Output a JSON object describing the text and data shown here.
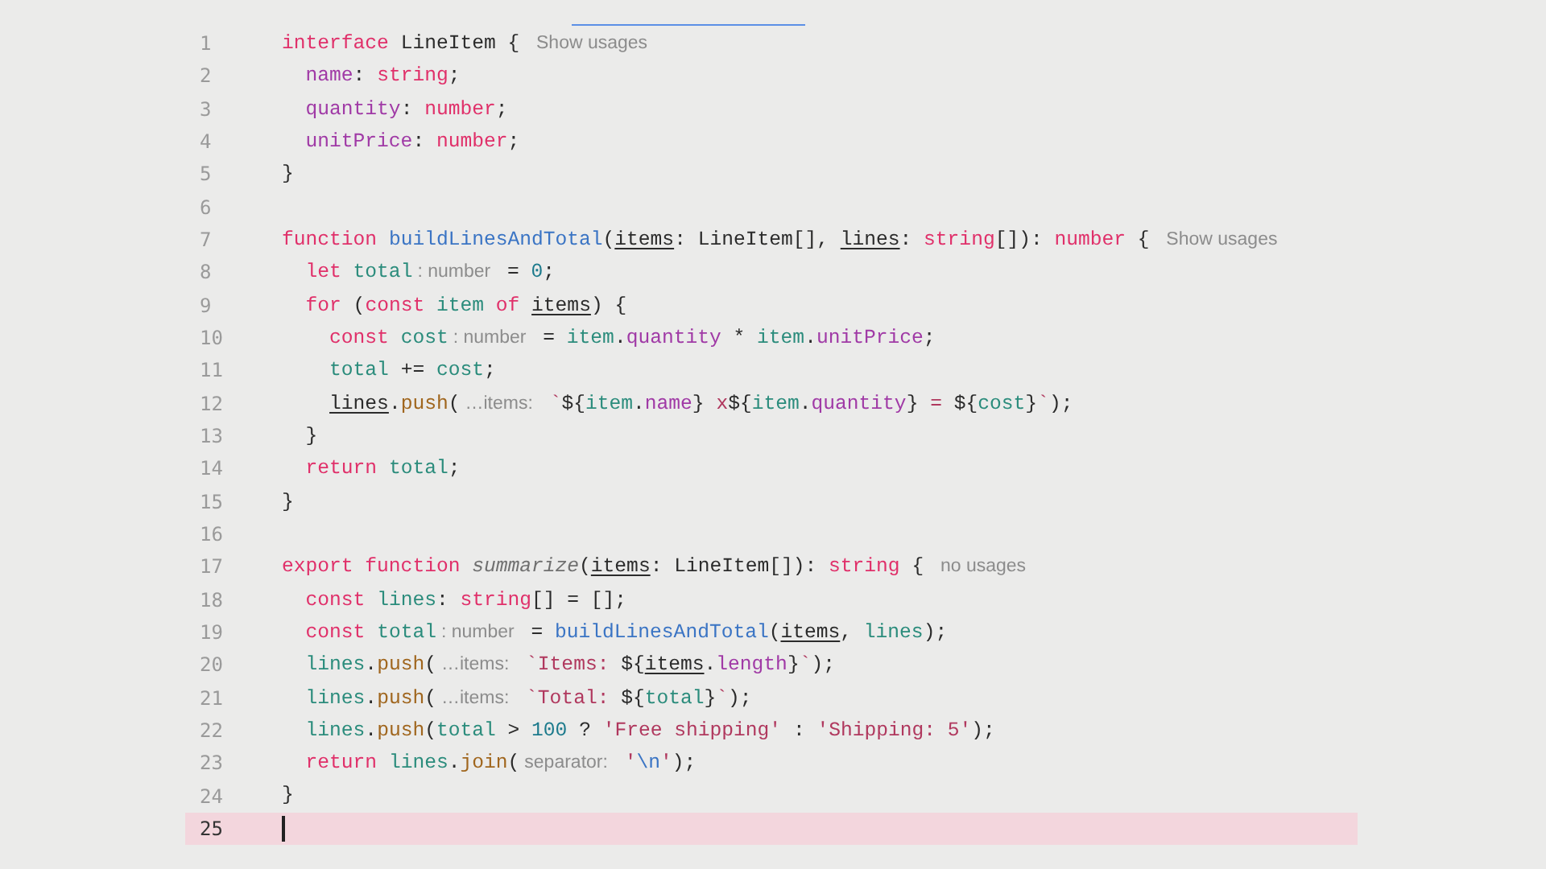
{
  "editor": {
    "lines": [
      {
        "number": "1",
        "current": false,
        "tokens": [
          {
            "text": "interface",
            "kind": "kw"
          },
          {
            "text": " LineItem { ",
            "kind": "plain"
          },
          {
            "text": "Show usages",
            "kind": "hint"
          }
        ]
      },
      {
        "number": "2",
        "current": false,
        "tokens": [
          {
            "text": "  name",
            "kind": "prop"
          },
          {
            "text": ": ",
            "kind": "plain"
          },
          {
            "text": "string",
            "kind": "type"
          },
          {
            "text": ";",
            "kind": "plain"
          }
        ]
      },
      {
        "number": "3",
        "current": false,
        "tokens": [
          {
            "text": "  quantity",
            "kind": "prop"
          },
          {
            "text": ": ",
            "kind": "plain"
          },
          {
            "text": "number",
            "kind": "type"
          },
          {
            "text": ";",
            "kind": "plain"
          }
        ]
      },
      {
        "number": "4",
        "current": false,
        "tokens": [
          {
            "text": "  unitPrice",
            "kind": "prop"
          },
          {
            "text": ": ",
            "kind": "plain"
          },
          {
            "text": "number",
            "kind": "type"
          },
          {
            "text": ";",
            "kind": "plain"
          }
        ]
      },
      {
        "number": "5",
        "current": false,
        "tokens": [
          {
            "text": "}",
            "kind": "plain"
          }
        ]
      },
      {
        "number": "6",
        "current": false
      },
      {
        "number": "7",
        "current": false,
        "tokens": [
          {
            "text": "function",
            "kind": "kw"
          },
          {
            "text": " buildLinesAndTotal",
            "kind": "fn"
          },
          {
            "text": "(",
            "kind": "plain"
          },
          {
            "text": "items",
            "kind": "param"
          },
          {
            "text": ": LineItem[], ",
            "kind": "plain"
          },
          {
            "text": "lines",
            "kind": "param"
          },
          {
            "text": ": ",
            "kind": "plain"
          },
          {
            "text": "string",
            "kind": "type"
          },
          {
            "text": "[]): ",
            "kind": "plain"
          },
          {
            "text": "number",
            "kind": "type"
          },
          {
            "text": " { ",
            "kind": "plain"
          },
          {
            "text": "Show usages",
            "kind": "hint"
          }
        ]
      },
      {
        "number": "8",
        "current": false,
        "tokens": [
          {
            "text": "  let",
            "kind": "kw"
          },
          {
            "text": " total",
            "kind": "var"
          },
          {
            "text": ": number",
            "kind": "hint"
          },
          {
            "text": " = ",
            "kind": "plain"
          },
          {
            "text": "0",
            "kind": "num"
          },
          {
            "text": ";",
            "kind": "plain"
          }
        ]
      },
      {
        "number": "9",
        "current": false,
        "tokens": [
          {
            "text": "  for",
            "kind": "kw"
          },
          {
            "text": " (",
            "kind": "plain"
          },
          {
            "text": "const",
            "kind": "kw"
          },
          {
            "text": " item",
            "kind": "var"
          },
          {
            "text": " of ",
            "kind": "kw"
          },
          {
            "text": "items",
            "kind": "param"
          },
          {
            "text": ") {",
            "kind": "plain"
          }
        ]
      },
      {
        "number": "10",
        "current": false,
        "tokens": [
          {
            "text": "    const",
            "kind": "kw"
          },
          {
            "text": " cost",
            "kind": "var"
          },
          {
            "text": ": number",
            "kind": "hint"
          },
          {
            "text": " = ",
            "kind": "plain"
          },
          {
            "text": "item",
            "kind": "var"
          },
          {
            "text": ".",
            "kind": "plain"
          },
          {
            "text": "quantity",
            "kind": "prop"
          },
          {
            "text": " * ",
            "kind": "plain"
          },
          {
            "text": "item",
            "kind": "var"
          },
          {
            "text": ".",
            "kind": "plain"
          },
          {
            "text": "unitPrice",
            "kind": "prop"
          },
          {
            "text": ";",
            "kind": "plain"
          }
        ]
      },
      {
        "number": "11",
        "current": false,
        "tokens": [
          {
            "text": "    total",
            "kind": "var"
          },
          {
            "text": " += ",
            "kind": "plain"
          },
          {
            "text": "cost",
            "kind": "var"
          },
          {
            "text": ";",
            "kind": "plain"
          }
        ]
      },
      {
        "number": "12",
        "current": false,
        "tokens": [
          {
            "text": "    lines",
            "kind": "param"
          },
          {
            "text": ".",
            "kind": "plain"
          },
          {
            "text": "push",
            "kind": "method"
          },
          {
            "text": "(",
            "kind": "plain"
          },
          {
            "text": "…items:",
            "kind": "hint"
          },
          {
            "text": " `",
            "kind": "str"
          },
          {
            "text": "${",
            "kind": "plain"
          },
          {
            "text": "item",
            "kind": "var"
          },
          {
            "text": ".",
            "kind": "plain"
          },
          {
            "text": "name",
            "kind": "prop"
          },
          {
            "text": "}",
            "kind": "plain"
          },
          {
            "text": " x",
            "kind": "str"
          },
          {
            "text": "${",
            "kind": "plain"
          },
          {
            "text": "item",
            "kind": "var"
          },
          {
            "text": ".",
            "kind": "plain"
          },
          {
            "text": "quantity",
            "kind": "prop"
          },
          {
            "text": "}",
            "kind": "plain"
          },
          {
            "text": " = ",
            "kind": "str"
          },
          {
            "text": "${",
            "kind": "plain"
          },
          {
            "text": "cost",
            "kind": "var"
          },
          {
            "text": "}",
            "kind": "plain"
          },
          {
            "text": "`",
            "kind": "str"
          },
          {
            "text": ");",
            "kind": "plain"
          }
        ]
      },
      {
        "number": "13",
        "current": false,
        "tokens": [
          {
            "text": "  }",
            "kind": "plain"
          }
        ]
      },
      {
        "number": "14",
        "current": false,
        "tokens": [
          {
            "text": "  return",
            "kind": "kw"
          },
          {
            "text": " total",
            "kind": "var"
          },
          {
            "text": ";",
            "kind": "plain"
          }
        ]
      },
      {
        "number": "15",
        "current": false,
        "tokens": [
          {
            "text": "}",
            "kind": "plain"
          }
        ]
      },
      {
        "number": "16",
        "current": false
      },
      {
        "number": "17",
        "current": false,
        "tokens": [
          {
            "text": "export",
            "kind": "kw"
          },
          {
            "text": " function",
            "kind": "kw"
          },
          {
            "text": " summarize",
            "kind": "unused"
          },
          {
            "text": "(",
            "kind": "plain"
          },
          {
            "text": "items",
            "kind": "param"
          },
          {
            "text": ": LineItem[]): ",
            "kind": "plain"
          },
          {
            "text": "string",
            "kind": "type"
          },
          {
            "text": " { ",
            "kind": "plain"
          },
          {
            "text": "no usages",
            "kind": "hint"
          }
        ]
      },
      {
        "number": "18",
        "current": false,
        "tokens": [
          {
            "text": "  const",
            "kind": "kw"
          },
          {
            "text": " lines",
            "kind": "var"
          },
          {
            "text": ": ",
            "kind": "plain"
          },
          {
            "text": "string",
            "kind": "type"
          },
          {
            "text": "[] = [];",
            "kind": "plain"
          }
        ]
      },
      {
        "number": "19",
        "current": false,
        "tokens": [
          {
            "text": "  const",
            "kind": "kw"
          },
          {
            "text": " total",
            "kind": "var"
          },
          {
            "text": ": number",
            "kind": "hint"
          },
          {
            "text": " = ",
            "kind": "plain"
          },
          {
            "text": "buildLinesAndTotal",
            "kind": "fn"
          },
          {
            "text": "(",
            "kind": "plain"
          },
          {
            "text": "items",
            "kind": "param"
          },
          {
            "text": ", ",
            "kind": "plain"
          },
          {
            "text": "lines",
            "kind": "var"
          },
          {
            "text": ");",
            "kind": "plain"
          }
        ]
      },
      {
        "number": "20",
        "current": false,
        "tokens": [
          {
            "text": "  lines",
            "kind": "var"
          },
          {
            "text": ".",
            "kind": "plain"
          },
          {
            "text": "push",
            "kind": "method"
          },
          {
            "text": "(",
            "kind": "plain"
          },
          {
            "text": "…items:",
            "kind": "hint"
          },
          {
            "text": " `Items: ",
            "kind": "str"
          },
          {
            "text": "${",
            "kind": "plain"
          },
          {
            "text": "items",
            "kind": "param"
          },
          {
            "text": ".",
            "kind": "plain"
          },
          {
            "text": "length",
            "kind": "prop"
          },
          {
            "text": "}",
            "kind": "plain"
          },
          {
            "text": "`",
            "kind": "str"
          },
          {
            "text": ");",
            "kind": "plain"
          }
        ]
      },
      {
        "number": "21",
        "current": false,
        "tokens": [
          {
            "text": "  lines",
            "kind": "var"
          },
          {
            "text": ".",
            "kind": "plain"
          },
          {
            "text": "push",
            "kind": "method"
          },
          {
            "text": "(",
            "kind": "plain"
          },
          {
            "text": "…items:",
            "kind": "hint"
          },
          {
            "text": " `Total: ",
            "kind": "str"
          },
          {
            "text": "${",
            "kind": "plain"
          },
          {
            "text": "total",
            "kind": "var"
          },
          {
            "text": "}",
            "kind": "plain"
          },
          {
            "text": "`",
            "kind": "str"
          },
          {
            "text": ");",
            "kind": "plain"
          }
        ]
      },
      {
        "number": "22",
        "current": false,
        "tokens": [
          {
            "text": "  lines",
            "kind": "var"
          },
          {
            "text": ".",
            "kind": "plain"
          },
          {
            "text": "push",
            "kind": "method"
          },
          {
            "text": "(",
            "kind": "plain"
          },
          {
            "text": "total",
            "kind": "var"
          },
          {
            "text": " > ",
            "kind": "plain"
          },
          {
            "text": "100",
            "kind": "num"
          },
          {
            "text": " ? ",
            "kind": "plain"
          },
          {
            "text": "'Free shipping'",
            "kind": "str"
          },
          {
            "text": " : ",
            "kind": "plain"
          },
          {
            "text": "'Shipping: 5'",
            "kind": "str"
          },
          {
            "text": ");",
            "kind": "plain"
          }
        ]
      },
      {
        "number": "23",
        "current": false,
        "tokens": [
          {
            "text": "  return",
            "kind": "kw"
          },
          {
            "text": " lines",
            "kind": "var"
          },
          {
            "text": ".",
            "kind": "plain"
          },
          {
            "text": "join",
            "kind": "method"
          },
          {
            "text": "(",
            "kind": "plain"
          },
          {
            "text": "separator:",
            "kind": "hint"
          },
          {
            "text": " '",
            "kind": "str"
          },
          {
            "text": "\\n",
            "kind": "esc"
          },
          {
            "text": "'",
            "kind": "str"
          },
          {
            "text": ");",
            "kind": "plain"
          }
        ]
      },
      {
        "number": "24",
        "current": false,
        "tokens": [
          {
            "text": "}",
            "kind": "plain"
          }
        ]
      },
      {
        "number": "25",
        "current": true
      }
    ]
  }
}
